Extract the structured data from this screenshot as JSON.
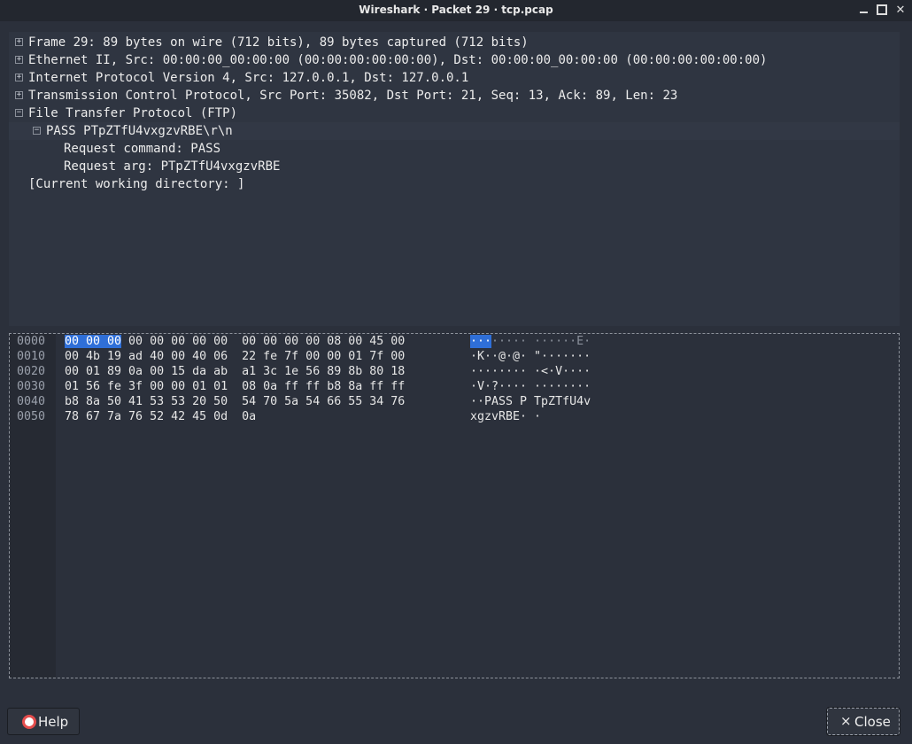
{
  "window": {
    "title": "Wireshark · Packet 29 · tcp.pcap",
    "minimize": "minimize",
    "maximize": "maximize",
    "close": "close"
  },
  "tree": [
    {
      "id": "frame",
      "text": "Frame 29: 89 bytes on wire (712 bits), 89 bytes captured (712 bits)",
      "expander": "+"
    },
    {
      "id": "ethernet",
      "text": "Ethernet II, Src: 00:00:00_00:00:00 (00:00:00:00:00:00), Dst: 00:00:00_00:00:00 (00:00:00:00:00:00)",
      "expander": "+"
    },
    {
      "id": "ipv4",
      "text": "Internet Protocol Version 4, Src: 127.0.0.1, Dst: 127.0.0.1",
      "expander": "+"
    },
    {
      "id": "tcp",
      "text": "Transmission Control Protocol, Src Port: 35082, Dst Port: 21, Seq: 13, Ack: 89, Len: 23",
      "expander": "+"
    },
    {
      "id": "ftp",
      "text": "File Transfer Protocol (FTP)",
      "expander": "−"
    },
    {
      "id": "ftp-pass",
      "text": "PASS PTpZTfU4vxgzvRBE\\r\\n",
      "expander": "−"
    },
    {
      "id": "req-cmd",
      "text": "Request command: PASS",
      "expander": ""
    },
    {
      "id": "req-arg",
      "text": "Request arg: PTpZTfU4vxgzvRBE",
      "expander": ""
    },
    {
      "id": "cwd",
      "text": "[Current working directory: ]",
      "expander": ""
    }
  ],
  "bytes": {
    "rows": [
      {
        "offset": "0000",
        "hex_sel": "00 00 00",
        "hex": " 00 00 00 00 00  00 00 00 00 08 00 45 00",
        "ascii_sel": "···",
        "ascii": "····· ······E·"
      },
      {
        "offset": "0010",
        "hex_sel": "",
        "hex": "00 4b 19 ad 40 00 40 06  22 fe 7f 00 00 01 7f 00",
        "ascii_sel": "",
        "ascii": "·K··@·@· \"·······"
      },
      {
        "offset": "0020",
        "hex_sel": "",
        "hex": "00 01 89 0a 00 15 da ab  a1 3c 1e 56 89 8b 80 18",
        "ascii_sel": "",
        "ascii": "········ ·<·V····"
      },
      {
        "offset": "0030",
        "hex_sel": "",
        "hex": "01 56 fe 3f 00 00 01 01  08 0a ff ff b8 8a ff ff",
        "ascii_sel": "",
        "ascii": "·V·?···· ········"
      },
      {
        "offset": "0040",
        "hex_sel": "",
        "hex": "b8 8a 50 41 53 53 20 50  54 70 5a 54 66 55 34 76",
        "ascii_sel": "",
        "ascii": "··PASS P TpZTfU4v"
      },
      {
        "offset": "0050",
        "hex_sel": "",
        "hex": "78 67 7a 76 52 42 45 0d  0a",
        "ascii_sel": "",
        "ascii": "xgzvRBE· ·"
      }
    ]
  },
  "buttons": {
    "help": "Help",
    "close": "Close"
  },
  "icons": {
    "help": "lifebuoy-icon",
    "close": "close-x-icon"
  },
  "colors": {
    "background": "#2b303b",
    "selection": "#2f6fd8",
    "help_icon": "#e44d4d"
  }
}
